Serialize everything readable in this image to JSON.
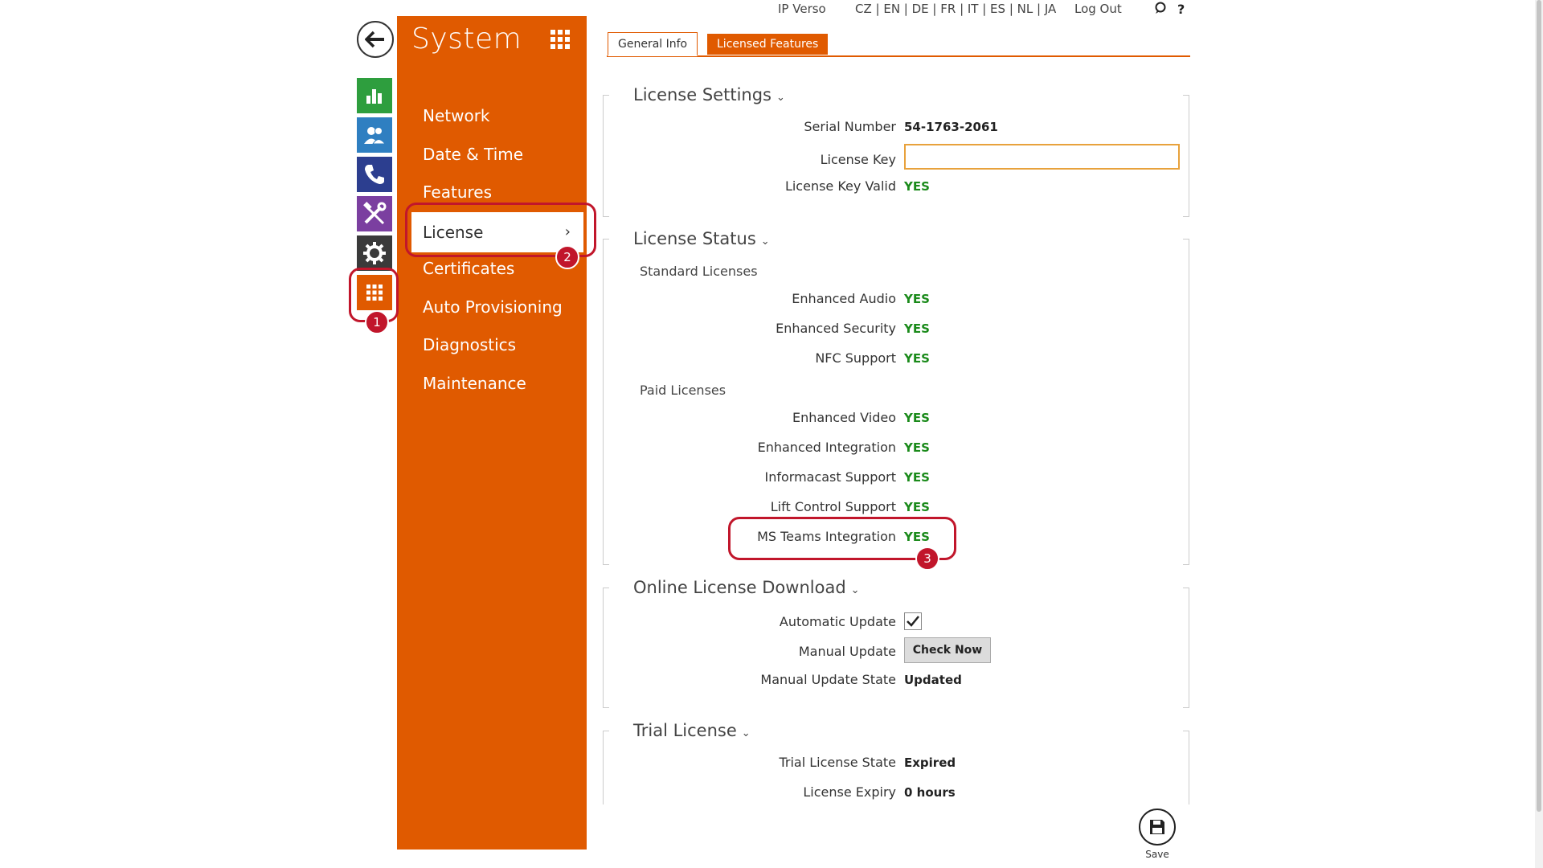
{
  "topbar": {
    "device": "IP Verso",
    "languages": "CZ | EN | DE | FR | IT | ES | NL | JA",
    "logout": "Log Out",
    "chat_icon": "chat-icon",
    "help": "?"
  },
  "rail": {
    "back_icon": "back-arrow-icon",
    "items": [
      {
        "icon": "status-chart-icon",
        "color": "#2e9e3e"
      },
      {
        "icon": "directory-users-icon",
        "color": "#2f7fc1"
      },
      {
        "icon": "phone-icon",
        "color": "#2c3e8f"
      },
      {
        "icon": "tools-icon",
        "color": "#7b3fa0"
      },
      {
        "icon": "gear-icon",
        "color": "#3a3a3a"
      },
      {
        "icon": "system-grid-icon",
        "color": "#e05a00"
      }
    ]
  },
  "system_panel": {
    "title": "System",
    "nav": [
      "Network",
      "Date & Time",
      "Features",
      "License",
      "Certificates",
      "Auto Provisioning",
      "Diagnostics",
      "Maintenance"
    ],
    "active": "License",
    "active_chevron": "›"
  },
  "callouts": [
    "1",
    "2",
    "3"
  ],
  "tabs": {
    "general": "General Info",
    "licensed": "Licensed Features"
  },
  "license_settings": {
    "title": "License Settings",
    "serial_label": "Serial Number",
    "serial_value": "54-1763-2061",
    "key_label": "License Key",
    "key_value": "",
    "valid_label": "License Key Valid",
    "valid_value": "YES"
  },
  "license_status": {
    "title": "License Status",
    "standard_title": "Standard Licenses",
    "standard": [
      {
        "label": "Enhanced Audio",
        "value": "YES"
      },
      {
        "label": "Enhanced Security",
        "value": "YES"
      },
      {
        "label": "NFC Support",
        "value": "YES"
      }
    ],
    "paid_title": "Paid Licenses",
    "paid": [
      {
        "label": "Enhanced Video",
        "value": "YES"
      },
      {
        "label": "Enhanced Integration",
        "value": "YES"
      },
      {
        "label": "Informacast Support",
        "value": "YES"
      },
      {
        "label": "Lift Control Support",
        "value": "YES"
      },
      {
        "label": "MS Teams Integration",
        "value": "YES"
      }
    ]
  },
  "online_download": {
    "title": "Online License Download",
    "auto_label": "Automatic Update",
    "auto_checked": true,
    "manual_label": "Manual Update",
    "manual_button": "Check Now",
    "state_label": "Manual Update State",
    "state_value": "Updated"
  },
  "trial": {
    "title": "Trial License",
    "state_label": "Trial License State",
    "state_value": "Expired",
    "expiry_label": "License Expiry",
    "expiry_value": "0 hours"
  },
  "save": {
    "label": "Save",
    "icon": "floppy-disk-icon"
  },
  "colors": {
    "accent": "#e05a00",
    "yes": "#1a8a1a",
    "callout": "#c1162b"
  }
}
